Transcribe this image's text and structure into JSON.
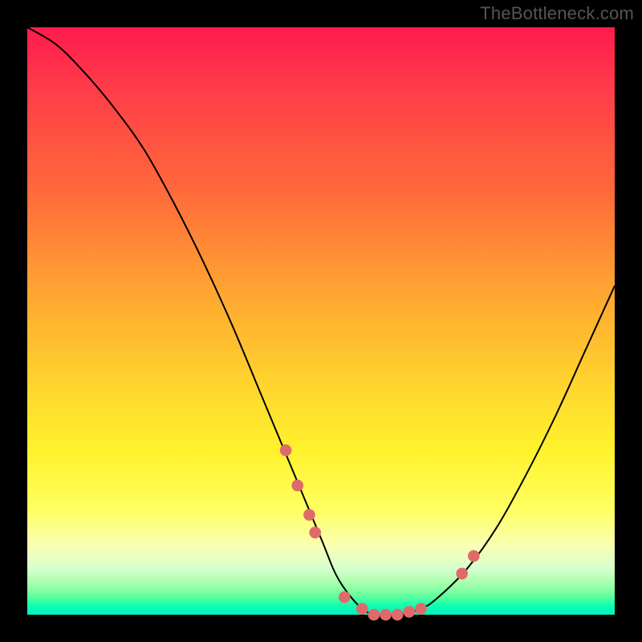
{
  "attribution": "TheBottleneck.com",
  "chart_data": {
    "type": "line",
    "title": "",
    "xlabel": "",
    "ylabel": "",
    "xlim": [
      0,
      100
    ],
    "ylim": [
      0,
      100
    ],
    "series": [
      {
        "name": "bottleneck-curve",
        "x": [
          0,
          5,
          10,
          15,
          20,
          25,
          30,
          35,
          40,
          45,
          50,
          53,
          57,
          60,
          63,
          67,
          70,
          75,
          80,
          85,
          90,
          95,
          100
        ],
        "values": [
          100,
          97,
          92,
          86,
          79,
          70,
          60,
          49,
          37,
          25,
          13,
          6,
          1,
          0,
          0,
          1,
          3,
          8,
          15,
          24,
          34,
          45,
          56
        ]
      }
    ],
    "markers": {
      "name": "highlighted-points",
      "color": "#e06a6a",
      "x": [
        44,
        46,
        48,
        49,
        54,
        57,
        59,
        61,
        63,
        65,
        67,
        74,
        76
      ],
      "values": [
        28,
        22,
        17,
        14,
        3,
        1,
        0,
        0,
        0,
        0.5,
        1,
        7,
        10
      ]
    }
  },
  "colors": {
    "curve": "#000000",
    "marker": "#e06a6a",
    "background_frame": "#000000"
  }
}
